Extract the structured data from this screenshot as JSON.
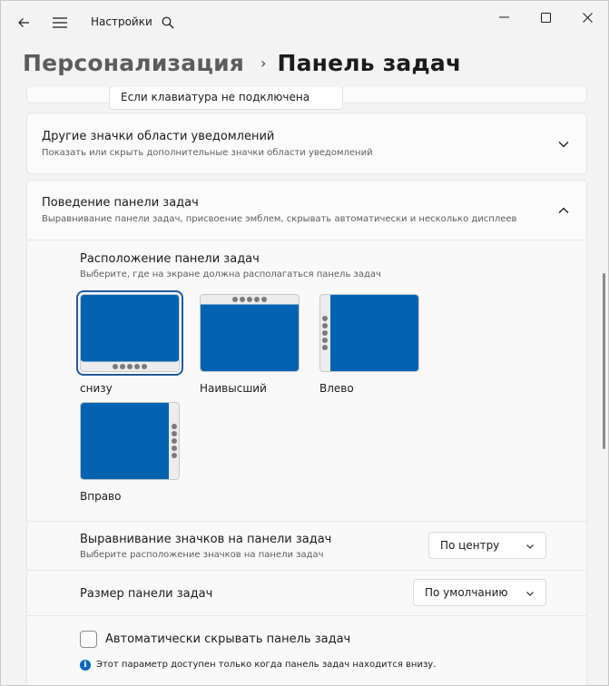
{
  "window": {
    "app_title": "Настройки",
    "minimize_label": "—",
    "maximize_label": "□",
    "close_label": "✕"
  },
  "breadcrumb": {
    "parent": "Персонализация",
    "separator": "›",
    "current": "Панель задач"
  },
  "partial_card": {
    "button_label": "Если клавиатура не подключена"
  },
  "other_icons": {
    "title": "Другие значки области уведомлений",
    "subtitle": "Показать или скрыть дополнительные значки области уведомлений"
  },
  "behavior": {
    "title": "Поведение панели задач",
    "subtitle": "Выравнивание панели задач, присвоение эмблем, скрывать автоматически и несколько дисплеев",
    "location": {
      "title": "Расположение панели задач",
      "subtitle": "Выберите, где на экране должна располагаться панель задач",
      "selected": "bottom",
      "options": [
        {
          "id": "bottom",
          "label": "снизу"
        },
        {
          "id": "top",
          "label": "Наивысший"
        },
        {
          "id": "left",
          "label": "Влево"
        },
        {
          "id": "right",
          "label": "Вправо"
        }
      ]
    },
    "alignment": {
      "title": "Выравнивание значков на панели задач",
      "subtitle": "Выберите расположение значков на панели задач",
      "value": "По центру"
    },
    "size": {
      "title": "Размер панели задач",
      "value": "По умолчанию"
    },
    "autohide": {
      "label": "Автоматически скрывать панель задач",
      "checked": false,
      "info": "Этот параметр доступен только когда панель задач находится внизу."
    }
  },
  "colors": {
    "accent": "#0063b1",
    "taskbar_bg": "#ececec",
    "selected_outline": "#1f5b9e"
  }
}
